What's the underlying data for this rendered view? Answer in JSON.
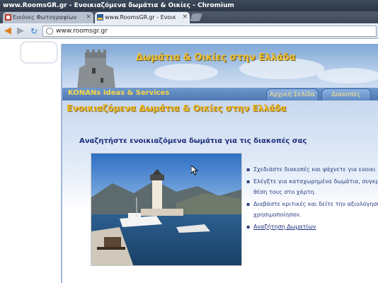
{
  "window": {
    "title": "www.RoomsGR.gr - Ενοικιαζόμενα δωμάτια & Οικίες - Chromium"
  },
  "tabs": [
    {
      "label": "Εικόνες Φωτογραφίων",
      "active": false
    },
    {
      "label": "www.RoomsGR.gr - Ενοικ",
      "active": true
    }
  ],
  "toolbar": {
    "address": "www.roomsgr.gr"
  },
  "site": {
    "banner_title": "Δωμάτια & Οικίες στην Ελλάδα",
    "brand": "KONANs Ideas & Services",
    "nav": {
      "home": "Αρχική Σελίδα",
      "vacations": "Διακοπές"
    },
    "heading": "Ενοικιαζόμενα Δωμάτια & Οικίες στην Ελλάδα",
    "subheading": "Αναζητήστε ενοικιαζόμενα δωμάτια για τις διακοπές σας",
    "features": [
      {
        "text": "Σχεδιάστε διακοπές και ψάχνετε για ενοικι"
      },
      {
        "text": "Ελέγξτε για καταχωρημένα δωμάτια, συγκρ",
        "line2": "θέση τους στο χάρτη."
      },
      {
        "text": "Διαβάστε κριτικές και δείτε την αξιολόγηση",
        "line2": "χρησιμοποίησαν."
      }
    ],
    "search_link": "Αναζήτηση Δωματίων"
  },
  "colors": {
    "heading": "#f0b824",
    "subheading": "#1d2d7a",
    "nav_blue": "#4d78b2",
    "brand_yellow": "#f7d64a"
  },
  "icons": [
    "back-arrow-icon",
    "forward-arrow-icon",
    "reload-icon",
    "globe-icon",
    "tab-close-icon",
    "mouse-cursor-icon"
  ]
}
